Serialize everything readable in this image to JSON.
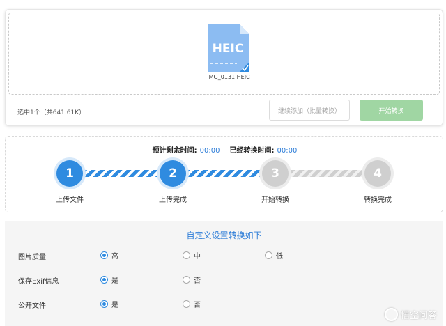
{
  "upload": {
    "file_type_badge": "HEIC",
    "file_name": "IMG_0131.HEIC",
    "selected_info": "选中1个（共641.61K）",
    "continue_button": "继续添加（批量转换）",
    "start_button": "开始转换",
    "colors": {
      "file_icon": "#8cbcf2",
      "start_button": "#a0d6a3"
    }
  },
  "progress": {
    "remaining_label": "预计剩余时间:",
    "remaining_value": "00:00",
    "elapsed_label": "已经转换时间:",
    "elapsed_value": "00:00",
    "steps": [
      {
        "number": "1",
        "label": "上传文件",
        "status": "active"
      },
      {
        "number": "2",
        "label": "上传完成",
        "status": "active"
      },
      {
        "number": "3",
        "label": "开始转换",
        "status": "inactive"
      },
      {
        "number": "4",
        "label": "转换完成",
        "status": "inactive"
      }
    ],
    "colors": {
      "active": "#2f8be0",
      "inactive": "#cfcfcf"
    }
  },
  "settings": {
    "title": "自定义设置转换如下",
    "rows": [
      {
        "label": "图片质量",
        "options": [
          "高",
          "中",
          "低"
        ],
        "selected": "高"
      },
      {
        "label": "保存Exif信息",
        "options": [
          "是",
          "否"
        ],
        "selected": "是"
      },
      {
        "label": "公开文件",
        "options": [
          "是",
          "否"
        ],
        "selected": "是"
      }
    ]
  },
  "watermark": {
    "text": "悟空问答"
  }
}
